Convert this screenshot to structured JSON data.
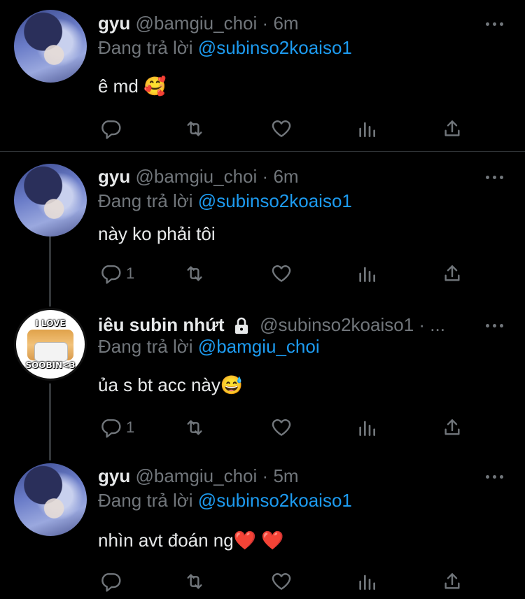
{
  "tweets": [
    {
      "name": "gyu",
      "handle": "@bamgiu_choi",
      "sep": "·",
      "time": "6m",
      "reply_prefix": "Đang trả lời",
      "reply_to": "@subinso2koaiso1",
      "text": "ê md 🥰",
      "reply_count": ""
    },
    {
      "name": "gyu",
      "handle": "@bamgiu_choi",
      "sep": "·",
      "time": "6m",
      "reply_prefix": "Đang trả lời",
      "reply_to": "@subinso2koaiso1",
      "text": "này ko phải tôi",
      "reply_count": "1"
    },
    {
      "name": "iêu subin nhứt",
      "handle": "@subinso2koaiso1 · ...",
      "sep": "",
      "time": "",
      "reply_prefix": "Đang trả lời",
      "reply_to": "@bamgiu_choi",
      "text": "ủa s bt acc này😅",
      "reply_count": "1",
      "avatar_text_top": "I LOVE",
      "avatar_text_bottom": "SOOBIN<3"
    },
    {
      "name": "gyu",
      "handle": "@bamgiu_choi",
      "sep": "·",
      "time": "5m",
      "reply_prefix": "Đang trả lời",
      "reply_to": "@subinso2koaiso1",
      "text": "nhìn avt đoán ng❤️ ❤️",
      "reply_count": ""
    }
  ],
  "icons": {
    "reply": "reply-icon",
    "retweet": "retweet-icon",
    "like": "like-icon",
    "views": "views-icon",
    "share": "share-icon",
    "more": "more-icon",
    "lock": "lock-icon"
  },
  "colors": {
    "background": "#000000",
    "text": "#e7e9ea",
    "muted": "#71767b",
    "link": "#1d9bf0",
    "divider": "#2f3336"
  }
}
